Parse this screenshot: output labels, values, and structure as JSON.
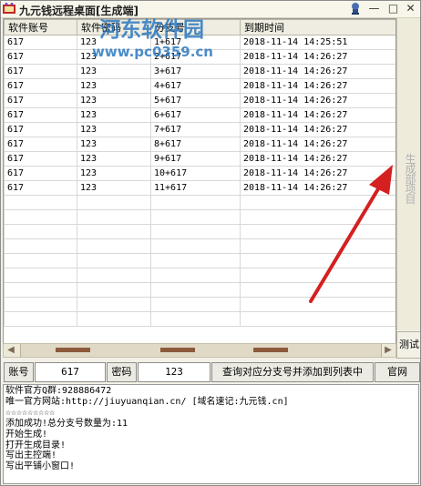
{
  "window": {
    "title": "九元钱远程桌面[生成端]",
    "buttons": [
      "—",
      "□",
      "✕"
    ]
  },
  "grid": {
    "columns": [
      "软件账号",
      "软件密码",
      "分支号",
      "到期时间"
    ],
    "rows": [
      [
        "617",
        "123",
        "1+617",
        "2018-11-14  14:25:51"
      ],
      [
        "617",
        "123",
        "2+617",
        "2018-11-14  14:26:27"
      ],
      [
        "617",
        "123",
        "3+617",
        "2018-11-14  14:26:27"
      ],
      [
        "617",
        "123",
        "4+617",
        "2018-11-14  14:26:27"
      ],
      [
        "617",
        "123",
        "5+617",
        "2018-11-14  14:26:27"
      ],
      [
        "617",
        "123",
        "6+617",
        "2018-11-14  14:26:27"
      ],
      [
        "617",
        "123",
        "7+617",
        "2018-11-14  14:26:27"
      ],
      [
        "617",
        "123",
        "8+617",
        "2018-11-14  14:26:27"
      ],
      [
        "617",
        "123",
        "9+617",
        "2018-11-14  14:26:27"
      ],
      [
        "617",
        "123",
        "10+617",
        "2018-11-14  14:26:27"
      ],
      [
        "617",
        "123",
        "11+617",
        "2018-11-14  14:26:27"
      ]
    ]
  },
  "side": {
    "generate_label": "生成部项目",
    "test_label": "测试"
  },
  "toolbar": {
    "account_label": "账号",
    "account_value": "617",
    "password_label": "密码",
    "password_value": "123",
    "query_label": "查询对应分支号并添加到列表中",
    "website_label": "官网"
  },
  "log": [
    "软件官方Q群:928886472",
    "唯一官方网站:http://jiuyuanqian.cn/ [域名速记:九元钱.cn]",
    "☆☆☆☆☆☆☆☆☆",
    "添加成功!总分支号数量为:11",
    "开始生成!",
    "打开生成目录!",
    "写出主控端!",
    "写出平铺小窗口!"
  ],
  "watermark": {
    "line1": "河东软件园",
    "line2": "www.pc0359.cn"
  },
  "colors": {
    "window_bg": "#f3f1e6",
    "arrow": "#d42020",
    "watermark_blue": "#2b78c0"
  },
  "icons": [
    "app-icon",
    "pin-icon",
    "scroll-left-icon",
    "scroll-right-icon",
    "red-arrow-annotation"
  ]
}
